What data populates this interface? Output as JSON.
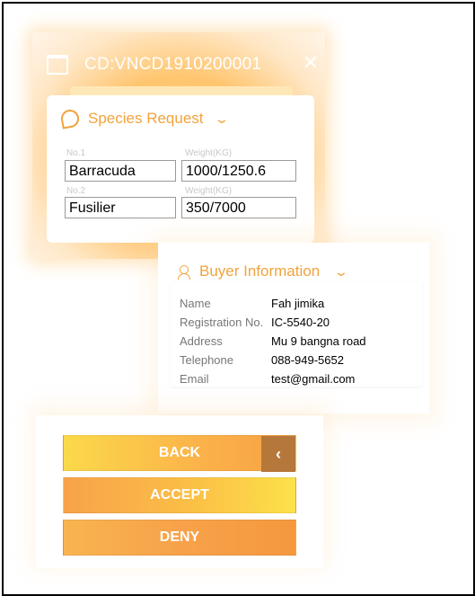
{
  "header": {
    "title": "CD:VNCD1910200001",
    "close_glyph": "✕",
    "cart_icon": "cart-icon"
  },
  "species": {
    "title": "Species Request",
    "chevron": "⌄",
    "items": [
      {
        "no_label": "No.1",
        "weight_label": "Weight(KG)",
        "name": "Barracuda",
        "weight": "1000/1250.6"
      },
      {
        "no_label": "No.2",
        "weight_label": "Weight(KG)",
        "name": "Fusilier",
        "weight": "350/7000"
      }
    ]
  },
  "buyer": {
    "title": "Buyer Information",
    "chevron": "⌄",
    "rows": [
      {
        "key": "Name",
        "value": "Fah jimika"
      },
      {
        "key": "Registration No.",
        "value": "IC-5540-20"
      },
      {
        "key": "Address",
        "value": "Mu 9 bangna road"
      },
      {
        "key": "Telephone",
        "value": "088-949-5652"
      },
      {
        "key": "Email",
        "value": "test@gmail.com"
      }
    ]
  },
  "buttons": {
    "back": "BACK",
    "back_side": "‹",
    "accept": "ACCEPT",
    "deny": "DENY"
  },
  "colors": {
    "accent": "#f2a33c",
    "back_side": "#b6773b"
  }
}
